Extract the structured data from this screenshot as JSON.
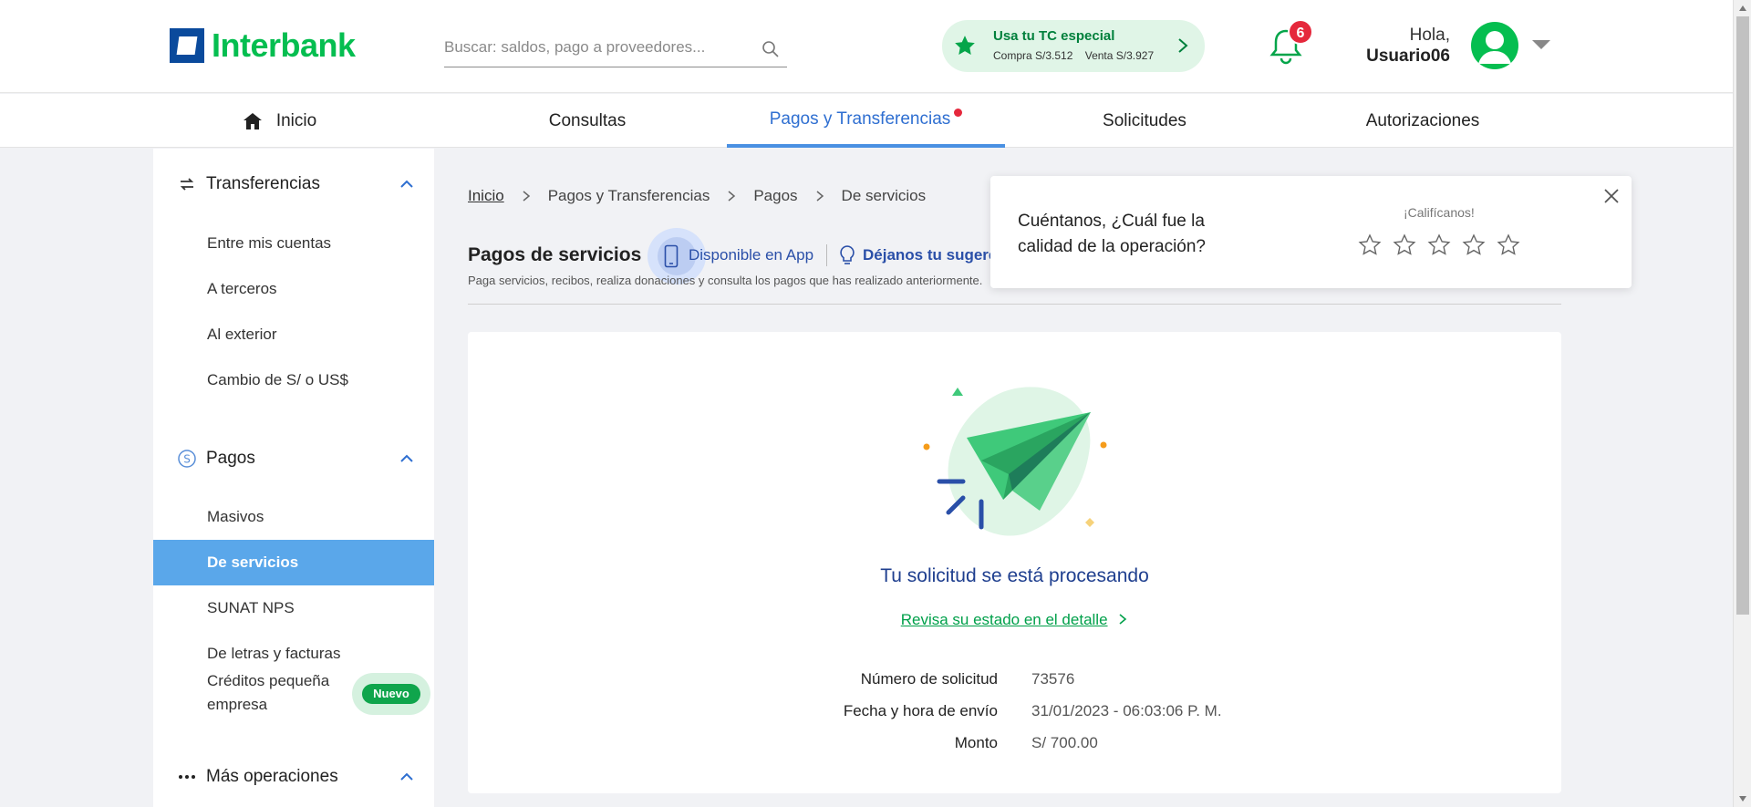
{
  "brand": {
    "logo_text": "Interbank",
    "color": "#05be50",
    "accent": "#0a4a9c"
  },
  "search": {
    "placeholder": "Buscar: saldos, pago a proveedores..."
  },
  "tc_promo": {
    "title": "Usa tu TC especial",
    "buy": "Compra S/3.512",
    "sell": "Venta S/3.927"
  },
  "notifications": {
    "count": "6"
  },
  "user": {
    "greeting": "Hola,",
    "name": "Usuario06"
  },
  "nav": {
    "items": [
      {
        "label": "Inicio"
      },
      {
        "label": "Consultas"
      },
      {
        "label": "Pagos y Transferencias",
        "active": true
      },
      {
        "label": "Solicitudes"
      },
      {
        "label": "Autorizaciones"
      }
    ]
  },
  "sidebar": {
    "sections": [
      {
        "label": "Transferencias",
        "items": [
          "Entre mis cuentas",
          "A terceros",
          "Al exterior",
          "Cambio de S/ o US$"
        ]
      },
      {
        "label": "Pagos",
        "items": [
          "Masivos",
          "De servicios",
          "SUNAT NPS",
          "De letras y facturas",
          "Créditos pequeña empresa"
        ]
      },
      {
        "label": "Más operaciones"
      }
    ],
    "badge_new": "Nuevo"
  },
  "breadcrumb": [
    "Inicio",
    "Pagos y Transferencias",
    "Pagos",
    "De servicios"
  ],
  "page": {
    "title": "Pagos de servicios",
    "app_label": "Disponible en App",
    "suggest_label": "Déjanos tu sugerencia",
    "subtitle": "Paga servicios, recibos, realiza donaciones y consulta los pagos que has realizado anteriormente."
  },
  "status": {
    "title": "Tu solicitud se está procesando",
    "link": "Revisa su estado en el detalle",
    "details": [
      {
        "label": "Número de solicitud",
        "value": "73576"
      },
      {
        "label": "Fecha y hora de envío",
        "value": "31/01/2023 - 06:03:06 P. M."
      },
      {
        "label": "Monto",
        "value": "S/ 700.00"
      }
    ]
  },
  "rating": {
    "question": "Cuéntanos, ¿Cuál fue la calidad de la operación?",
    "cta": "¡Califícanos!",
    "stars": 5
  }
}
